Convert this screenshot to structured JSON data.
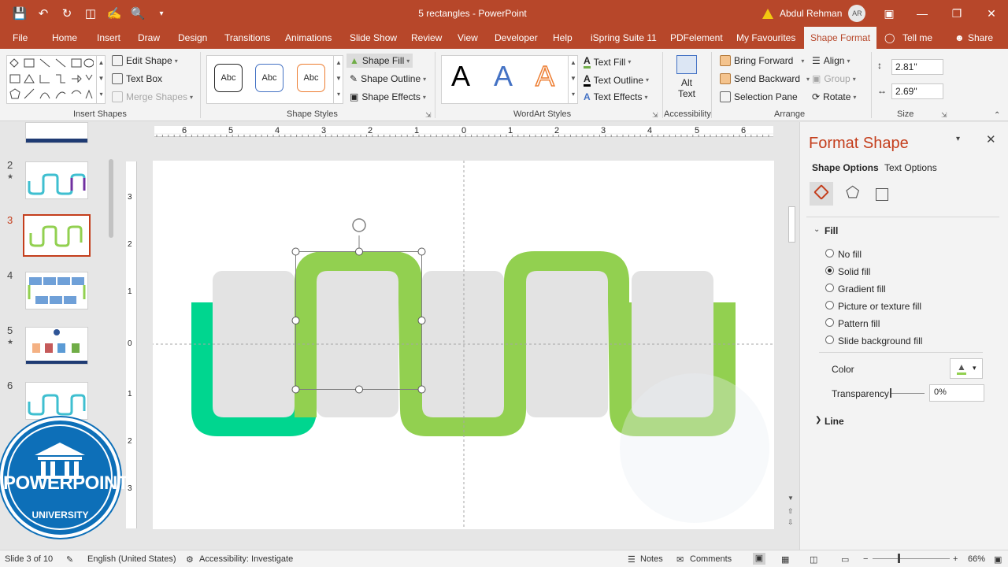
{
  "app": {
    "title": "5 rectangles - PowerPoint",
    "user_name": "Abdul Rehman",
    "user_initials": "AR"
  },
  "tabs": [
    "File",
    "Home",
    "Insert",
    "Draw",
    "Design",
    "Transitions",
    "Animations",
    "Slide Show",
    "Review",
    "View",
    "Developer",
    "Help",
    "iSpring Suite 11",
    "PDFelement",
    "My Favourites",
    "Shape Format",
    "Tell me",
    "Share"
  ],
  "ribbon": {
    "insert_shapes": {
      "edit_shape": "Edit Shape",
      "text_box": "Text Box",
      "merge_shapes": "Merge Shapes",
      "label": "Insert Shapes"
    },
    "shape_styles": {
      "preset1": "Abc",
      "preset2": "Abc",
      "preset3": "Abc",
      "shape_fill": "Shape Fill",
      "shape_outline": "Shape Outline",
      "shape_effects": "Shape Effects",
      "label": "Shape Styles"
    },
    "wordart": {
      "a": "A",
      "text_fill": "Text Fill",
      "text_outline": "Text Outline",
      "text_effects": "Text Effects",
      "label": "WordArt Styles"
    },
    "accessibility": {
      "alt_text_1": "Alt",
      "alt_text_2": "Text",
      "label": "Accessibility"
    },
    "arrange": {
      "bring_forward": "Bring Forward",
      "send_backward": "Send Backward",
      "selection_pane": "Selection Pane",
      "align": "Align",
      "group": "Group",
      "rotate": "Rotate",
      "label": "Arrange"
    },
    "size": {
      "height": "2.81\"",
      "width": "2.69\"",
      "label": "Size"
    }
  },
  "thumbnails": {
    "numbers": [
      "2",
      "3",
      "4",
      "5",
      "6"
    ],
    "current": "3"
  },
  "ruler": {
    "h_ticks": [
      "6",
      "5",
      "4",
      "3",
      "2",
      "1",
      "0",
      "1",
      "2",
      "3",
      "4",
      "5",
      "6"
    ],
    "v_ticks": [
      "3",
      "2",
      "1",
      "0",
      "1",
      "2",
      "3"
    ]
  },
  "format_panel": {
    "title": "Format Shape",
    "tab_shape": "Shape Options",
    "tab_text": "Text Options",
    "fill_section": "Fill",
    "options": [
      "No fill",
      "Solid fill",
      "Gradient fill",
      "Picture or texture fill",
      "Pattern fill",
      "Slide background fill"
    ],
    "selected_option": "Solid fill",
    "color_label": "Color",
    "transparency_label": "Transparency",
    "transparency_value": "0%",
    "line_section": "Line"
  },
  "status": {
    "slide": "Slide 3 of 10",
    "language": "English (United States)",
    "accessibility": "Accessibility: Investigate",
    "notes": "Notes",
    "comments": "Comments",
    "zoom": "66%"
  },
  "logo": {
    "line1": "POWERPOINT",
    "line2": "UNIVERSITY"
  },
  "colors": {
    "accent": "#b7472a",
    "green": "#92d050",
    "teal": "#00d68f",
    "grey_rect": "#e3e3e3"
  }
}
